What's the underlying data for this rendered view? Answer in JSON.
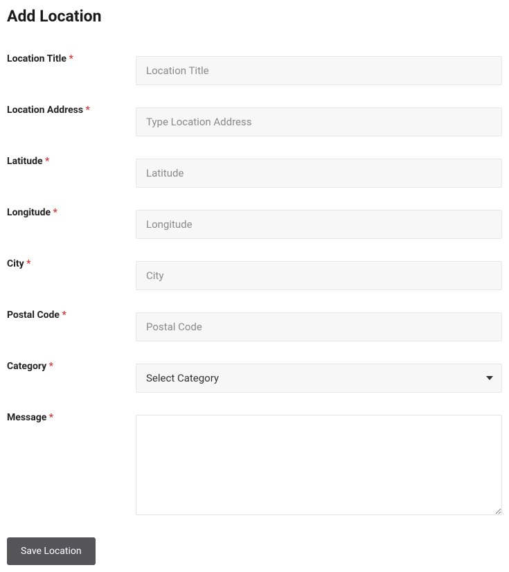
{
  "page": {
    "title": "Add Location"
  },
  "fields": {
    "location_title": {
      "label": "Location Title",
      "required": "*",
      "placeholder": "Location Title",
      "value": ""
    },
    "location_address": {
      "label": "Location Address",
      "required": "*",
      "placeholder": "Type Location Address",
      "value": ""
    },
    "latitude": {
      "label": "Latitude",
      "required": "*",
      "placeholder": "Latitude",
      "value": ""
    },
    "longitude": {
      "label": "Longitude",
      "required": "*",
      "placeholder": "Longitude",
      "value": ""
    },
    "city": {
      "label": "City",
      "required": "*",
      "placeholder": "City",
      "value": ""
    },
    "postal_code": {
      "label": "Postal Code",
      "required": "*",
      "placeholder": "Postal Code",
      "value": ""
    },
    "category": {
      "label": "Category",
      "required": "*",
      "selected": "Select Category"
    },
    "message": {
      "label": "Message",
      "required": "*",
      "value": ""
    }
  },
  "actions": {
    "submit_label": "Save Location"
  }
}
